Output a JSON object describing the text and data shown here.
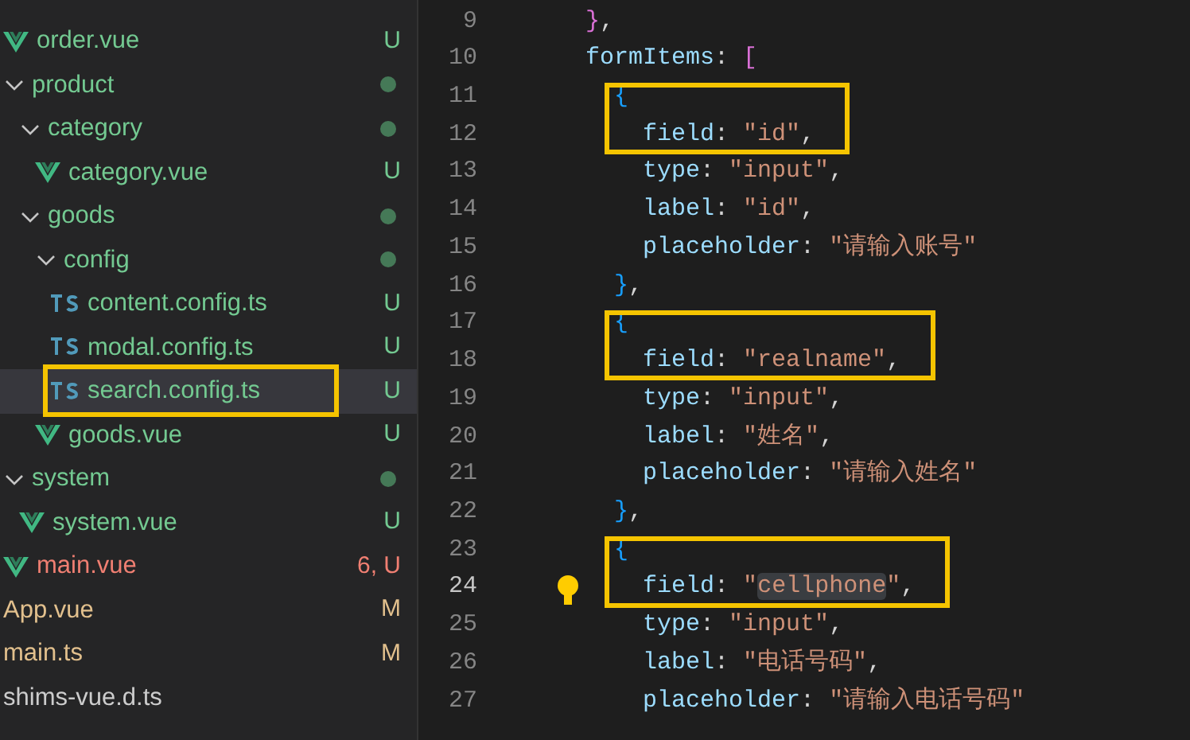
{
  "explorer": {
    "items": [
      {
        "label": "order.vue",
        "kind": "vue",
        "status": "U",
        "color": "#73c991",
        "selected": false,
        "boxed": false
      },
      {
        "label": "product",
        "kind": "folder",
        "color": "#73c991",
        "expanded": true,
        "selected": false,
        "boxed": false,
        "children": [
          {
            "label": "category",
            "kind": "folder",
            "color": "#73c991",
            "expanded": true,
            "selected": false,
            "boxed": false,
            "children": [
              {
                "label": "category.vue",
                "kind": "vue",
                "status": "U",
                "color": "#73c991",
                "selected": false,
                "boxed": false
              }
            ]
          },
          {
            "label": "goods",
            "kind": "folder",
            "color": "#73c991",
            "expanded": true,
            "selected": false,
            "boxed": false,
            "children": [
              {
                "label": "config",
                "kind": "folder",
                "color": "#73c991",
                "expanded": true,
                "selected": false,
                "boxed": false,
                "children": [
                  {
                    "label": "content.config.ts",
                    "kind": "ts",
                    "status": "U",
                    "color": "#73c991",
                    "selected": false,
                    "boxed": false
                  },
                  {
                    "label": "modal.config.ts",
                    "kind": "ts",
                    "status": "U",
                    "color": "#73c991",
                    "selected": false,
                    "boxed": false
                  },
                  {
                    "label": "search.config.ts",
                    "kind": "ts",
                    "status": "U",
                    "color": "#73c991",
                    "selected": true,
                    "boxed": true
                  }
                ]
              },
              {
                "label": "goods.vue",
                "kind": "vue",
                "status": "U",
                "color": "#73c991",
                "selected": false,
                "boxed": false
              }
            ]
          }
        ]
      },
      {
        "label": "system",
        "kind": "folder",
        "color": "#73c991",
        "expanded": true,
        "selected": false,
        "boxed": false,
        "children": [
          {
            "label": "system.vue",
            "kind": "vue",
            "status": "U",
            "color": "#73c991",
            "selected": false,
            "boxed": false
          }
        ]
      },
      {
        "label": "main.vue",
        "kind": "vue",
        "status": "6, U",
        "color": "#f07f72",
        "selected": false,
        "boxed": false
      },
      {
        "label": "App.vue",
        "kind": "plain",
        "status": "M",
        "color": "#e2c08d",
        "selected": false,
        "boxed": false
      },
      {
        "label": "main.ts",
        "kind": "plain",
        "status": "M",
        "color": "#e2c08d",
        "selected": false,
        "boxed": false
      },
      {
        "label": "shims-vue.d.ts",
        "kind": "plain",
        "color": "#cccccc",
        "selected": false,
        "boxed": false
      }
    ]
  },
  "editor": {
    "lines": [
      {
        "number": "9",
        "current": false,
        "boxed": false,
        "tokens": [
          {
            "kind": "bracket1",
            "text": "}"
          },
          {
            "kind": "punct",
            "text": ","
          }
        ]
      },
      {
        "number": "10",
        "current": false,
        "boxed": false,
        "tokens": [
          {
            "kind": "key",
            "text": "formItems"
          },
          {
            "kind": "punct",
            "text": ": "
          },
          {
            "kind": "bracket1",
            "text": "["
          }
        ]
      },
      {
        "number": "11",
        "current": false,
        "boxed": true,
        "tokens": [
          {
            "kind": "bracket2",
            "text": "  {"
          }
        ]
      },
      {
        "number": "12",
        "current": false,
        "boxed": true,
        "tokens": [
          {
            "kind": "key",
            "text": "    field"
          },
          {
            "kind": "punct",
            "text": ": "
          },
          {
            "kind": "string",
            "text": "\"id\""
          },
          {
            "kind": "punct",
            "text": ","
          }
        ]
      },
      {
        "number": "13",
        "current": false,
        "boxed": false,
        "tokens": [
          {
            "kind": "key",
            "text": "    type"
          },
          {
            "kind": "punct",
            "text": ": "
          },
          {
            "kind": "string",
            "text": "\"input\""
          },
          {
            "kind": "punct",
            "text": ","
          }
        ]
      },
      {
        "number": "14",
        "current": false,
        "boxed": false,
        "tokens": [
          {
            "kind": "key",
            "text": "    label"
          },
          {
            "kind": "punct",
            "text": ": "
          },
          {
            "kind": "string",
            "text": "\"id\""
          },
          {
            "kind": "punct",
            "text": ","
          }
        ]
      },
      {
        "number": "15",
        "current": false,
        "boxed": false,
        "tokens": [
          {
            "kind": "key",
            "text": "    placeholder"
          },
          {
            "kind": "punct",
            "text": ": "
          },
          {
            "kind": "string",
            "text": "\"请输入账号\""
          }
        ]
      },
      {
        "number": "16",
        "current": false,
        "boxed": false,
        "tokens": [
          {
            "kind": "bracket2",
            "text": "  }"
          },
          {
            "kind": "punct",
            "text": ","
          }
        ]
      },
      {
        "number": "17",
        "current": false,
        "boxed": true,
        "tokens": [
          {
            "kind": "bracket2",
            "text": "  {"
          }
        ]
      },
      {
        "number": "18",
        "current": false,
        "boxed": true,
        "tokens": [
          {
            "kind": "key",
            "text": "    field"
          },
          {
            "kind": "punct",
            "text": ": "
          },
          {
            "kind": "string",
            "text": "\"realname\""
          },
          {
            "kind": "punct",
            "text": ","
          }
        ]
      },
      {
        "number": "19",
        "current": false,
        "boxed": false,
        "tokens": [
          {
            "kind": "key",
            "text": "    type"
          },
          {
            "kind": "punct",
            "text": ": "
          },
          {
            "kind": "string",
            "text": "\"input\""
          },
          {
            "kind": "punct",
            "text": ","
          }
        ]
      },
      {
        "number": "20",
        "current": false,
        "boxed": false,
        "tokens": [
          {
            "kind": "key",
            "text": "    label"
          },
          {
            "kind": "punct",
            "text": ": "
          },
          {
            "kind": "string",
            "text": "\"姓名\""
          },
          {
            "kind": "punct",
            "text": ","
          }
        ]
      },
      {
        "number": "21",
        "current": false,
        "boxed": false,
        "tokens": [
          {
            "kind": "key",
            "text": "    placeholder"
          },
          {
            "kind": "punct",
            "text": ": "
          },
          {
            "kind": "string",
            "text": "\"请输入姓名\""
          }
        ]
      },
      {
        "number": "22",
        "current": false,
        "boxed": false,
        "tokens": [
          {
            "kind": "bracket2",
            "text": "  }"
          },
          {
            "kind": "punct",
            "text": ","
          }
        ]
      },
      {
        "number": "23",
        "current": false,
        "boxed": true,
        "tokens": [
          {
            "kind": "bracket2",
            "text": "  {"
          }
        ]
      },
      {
        "number": "24",
        "current": true,
        "boxed": true,
        "tokens": [
          {
            "kind": "key",
            "text": "    field"
          },
          {
            "kind": "punct",
            "text": ": "
          },
          {
            "kind": "string",
            "text": "\""
          },
          {
            "kind": "match",
            "text": "cellphone"
          },
          {
            "kind": "string",
            "text": "\""
          },
          {
            "kind": "punct",
            "text": ","
          }
        ]
      },
      {
        "number": "25",
        "current": false,
        "boxed": false,
        "tokens": [
          {
            "kind": "key",
            "text": "    type"
          },
          {
            "kind": "punct",
            "text": ": "
          },
          {
            "kind": "string",
            "text": "\"input\""
          },
          {
            "kind": "punct",
            "text": ","
          }
        ]
      },
      {
        "number": "26",
        "current": false,
        "boxed": false,
        "tokens": [
          {
            "kind": "key",
            "text": "    label"
          },
          {
            "kind": "punct",
            "text": ": "
          },
          {
            "kind": "string",
            "text": "\"电话号码\""
          },
          {
            "kind": "punct",
            "text": ","
          }
        ]
      },
      {
        "number": "27",
        "current": false,
        "boxed": false,
        "tokens": [
          {
            "kind": "key",
            "text": "    placeholder"
          },
          {
            "kind": "punct",
            "text": ": "
          },
          {
            "kind": "string",
            "text": "\"请输入电话号码\""
          }
        ]
      }
    ]
  }
}
